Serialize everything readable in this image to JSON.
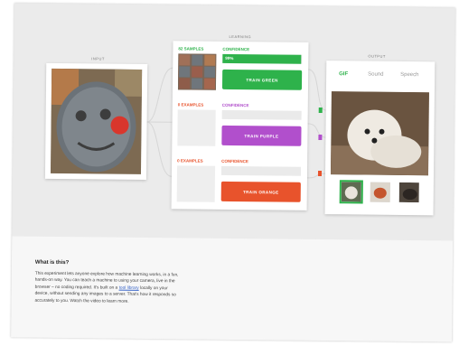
{
  "header": {
    "input_label": "input",
    "learning_label": "learning",
    "output_label": "output"
  },
  "learning": {
    "classes": [
      {
        "samples_label": "82 SAMPLES",
        "confidence_label": "CONFIDENCE",
        "confidence_text": "99%",
        "confidence": 0.99,
        "button_label": "TRAIN GREEN",
        "color": "#2eb24b"
      },
      {
        "samples_label": "0 EXAMPLES",
        "confidence_label": "CONFIDENCE",
        "confidence_text": "",
        "confidence": 0.0,
        "button_label": "TRAIN PURPLE",
        "color": "#b14fcc"
      },
      {
        "samples_label": "0 EXAMPLES",
        "confidence_label": "CONFIDENCE",
        "confidence_text": "",
        "confidence": 0.0,
        "button_label": "TRAIN ORANGE",
        "color": "#e8532c"
      }
    ]
  },
  "output": {
    "tabs": [
      "GIF",
      "Sound",
      "Speech"
    ],
    "active_tab": 0
  },
  "about": {
    "title": "What is this?",
    "body_before": "This experiment lets anyone explore how machine learning works, in a fun, hands-on way. You can teach a machine to using your camera, live in the browser – no coding required. It's built on a ",
    "link_text": "tool library",
    "body_after": " locally on your device, without sending any images to a server. That's how it responds so accurately to you. Watch the video to learn more."
  },
  "colors": {
    "green": "#2eb24b",
    "purple": "#b14fcc",
    "orange": "#e8532c",
    "link": "#3a66c9"
  },
  "icons": {
    "input": "webcam-photo",
    "output": "dog-gif-photo"
  }
}
